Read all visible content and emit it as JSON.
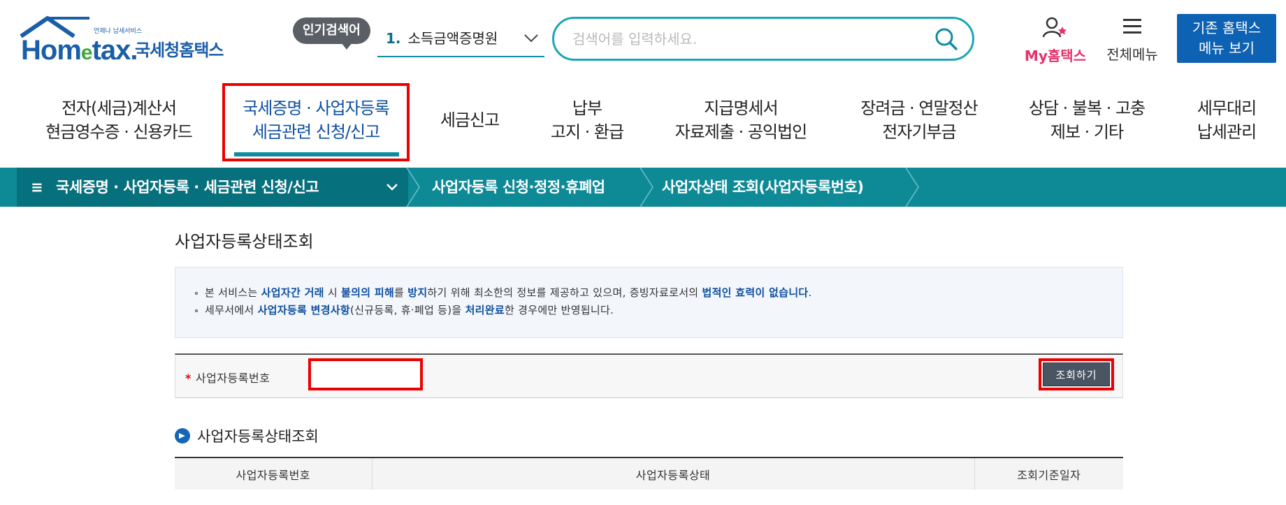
{
  "logo": {
    "small": "언제나 납세서비스",
    "brand_a": "Hom",
    "brand_e": "e",
    "brand_b": "tax.",
    "kr": "국세청홈택스"
  },
  "popular": {
    "label": "인기검색어",
    "rank": "1.",
    "term": "소득금액증명원"
  },
  "search": {
    "placeholder": "검색어를 입력하세요."
  },
  "util": {
    "my_label": "My홈택스",
    "allmenu_label": "전체메뉴",
    "oldmenu_line1": "기존 홈택스",
    "oldmenu_line2": "메뉴 보기"
  },
  "gnb": [
    {
      "line1": "전자(세금)계산서",
      "line2": "현금영수증 · 신용카드"
    },
    {
      "line1": "국세증명 · 사업자등록",
      "line2": "세금관련 신청/신고"
    },
    {
      "line1": "세금신고",
      "line2": ""
    },
    {
      "line1": "납부",
      "line2": "고지 · 환급"
    },
    {
      "line1": "지급명세서",
      "line2": "자료제출 · 공익법인"
    },
    {
      "line1": "장려금 · 연말정산",
      "line2": "전자기부금"
    },
    {
      "line1": "상담 · 불복 · 고충",
      "line2": "제보 · 기타"
    },
    {
      "line1": "세무대리",
      "line2": "납세관리"
    }
  ],
  "lnb": {
    "menu_icon": "≡",
    "level1": "국세증명 · 사업자등록 · 세금관련 신청/신고",
    "level2": "사업자등록 신청·정정·휴폐업",
    "level3": "사업자상태 조회(사업자등록번호)"
  },
  "page": {
    "title": "사업자등록상태조회"
  },
  "notice": {
    "l1": [
      {
        "t": "본 서비스는 ",
        "b": false
      },
      {
        "t": "사업자간 거래",
        "b": true
      },
      {
        "t": " 시 ",
        "b": false
      },
      {
        "t": "불의의 피해",
        "b": true
      },
      {
        "t": "를 ",
        "b": false
      },
      {
        "t": "방지",
        "b": true
      },
      {
        "t": "하기 위해 최소한의 정보를 제공하고 있으며, 증빙자료로서의 ",
        "b": false
      },
      {
        "t": "법적인 효력이 없습니다",
        "b": true
      },
      {
        "t": ".",
        "b": false
      }
    ],
    "l2": [
      {
        "t": "세무서에서 ",
        "b": false
      },
      {
        "t": "사업자등록 변경사항",
        "b": true
      },
      {
        "t": "(신규등록, 휴·폐업 등)을 ",
        "b": false
      },
      {
        "t": "처리완료",
        "b": true
      },
      {
        "t": "한 경우에만 반영됩니다.",
        "b": false
      }
    ]
  },
  "form": {
    "required_mark": "*",
    "label": "사업자등록번호",
    "value": "",
    "button": "조회하기"
  },
  "result": {
    "title": "사업자등록상태조회",
    "columns": [
      "사업자등록번호",
      "사업자등록상태",
      "조회기준일자"
    ]
  },
  "colors": {
    "lnb_bg": "#0e8a96",
    "accent": "#0e4fa0",
    "highlight": "#ee0000"
  }
}
